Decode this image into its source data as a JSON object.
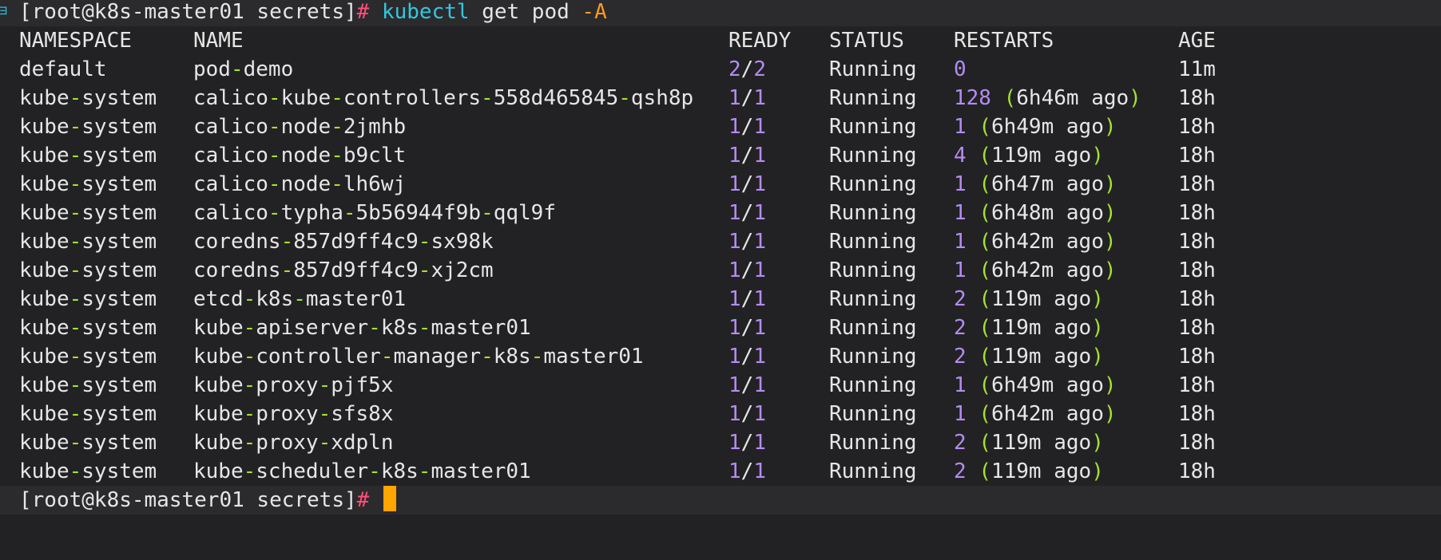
{
  "prompt": {
    "user_host": "[root@k8s-master01 secrets]",
    "symbol": "#",
    "command_name": "kubectl",
    "command_args": "get pod",
    "command_flag": "-A"
  },
  "table": {
    "headers": {
      "namespace": "NAMESPACE",
      "name": "NAME",
      "ready": "READY",
      "status": "STATUS",
      "restarts": "RESTARTS",
      "age": "AGE"
    },
    "rows": [
      {
        "namespace": "default",
        "name": "pod-demo",
        "ready": "2/2",
        "status": "Running",
        "restarts": "0",
        "ago": "",
        "age": "11m"
      },
      {
        "namespace": "kube-system",
        "name": "calico-kube-controllers-558d465845-qsh8p",
        "ready": "1/1",
        "status": "Running",
        "restarts": "128",
        "ago": "6h46m ago",
        "age": "18h"
      },
      {
        "namespace": "kube-system",
        "name": "calico-node-2jmhb",
        "ready": "1/1",
        "status": "Running",
        "restarts": "1",
        "ago": "6h49m ago",
        "age": "18h"
      },
      {
        "namespace": "kube-system",
        "name": "calico-node-b9clt",
        "ready": "1/1",
        "status": "Running",
        "restarts": "4",
        "ago": "119m ago",
        "age": "18h"
      },
      {
        "namespace": "kube-system",
        "name": "calico-node-lh6wj",
        "ready": "1/1",
        "status": "Running",
        "restarts": "1",
        "ago": "6h47m ago",
        "age": "18h"
      },
      {
        "namespace": "kube-system",
        "name": "calico-typha-5b56944f9b-qql9f",
        "ready": "1/1",
        "status": "Running",
        "restarts": "1",
        "ago": "6h48m ago",
        "age": "18h"
      },
      {
        "namespace": "kube-system",
        "name": "coredns-857d9ff4c9-sx98k",
        "ready": "1/1",
        "status": "Running",
        "restarts": "1",
        "ago": "6h42m ago",
        "age": "18h"
      },
      {
        "namespace": "kube-system",
        "name": "coredns-857d9ff4c9-xj2cm",
        "ready": "1/1",
        "status": "Running",
        "restarts": "1",
        "ago": "6h42m ago",
        "age": "18h"
      },
      {
        "namespace": "kube-system",
        "name": "etcd-k8s-master01",
        "ready": "1/1",
        "status": "Running",
        "restarts": "2",
        "ago": "119m ago",
        "age": "18h"
      },
      {
        "namespace": "kube-system",
        "name": "kube-apiserver-k8s-master01",
        "ready": "1/1",
        "status": "Running",
        "restarts": "2",
        "ago": "119m ago",
        "age": "18h"
      },
      {
        "namespace": "kube-system",
        "name": "kube-controller-manager-k8s-master01",
        "ready": "1/1",
        "status": "Running",
        "restarts": "2",
        "ago": "119m ago",
        "age": "18h"
      },
      {
        "namespace": "kube-system",
        "name": "kube-proxy-pjf5x",
        "ready": "1/1",
        "status": "Running",
        "restarts": "1",
        "ago": "6h49m ago",
        "age": "18h"
      },
      {
        "namespace": "kube-system",
        "name": "kube-proxy-sfs8x",
        "ready": "1/1",
        "status": "Running",
        "restarts": "1",
        "ago": "6h42m ago",
        "age": "18h"
      },
      {
        "namespace": "kube-system",
        "name": "kube-proxy-xdpln",
        "ready": "1/1",
        "status": "Running",
        "restarts": "2",
        "ago": "119m ago",
        "age": "18h"
      },
      {
        "namespace": "kube-system",
        "name": "kube-scheduler-k8s-master01",
        "ready": "1/1",
        "status": "Running",
        "restarts": "2",
        "ago": "119m ago",
        "age": "18h"
      }
    ]
  },
  "colors": {
    "background": "#222224",
    "text": "#e6e6e6",
    "dash": "#a6e22e",
    "number": "#b48cf2",
    "command": "#33c7de",
    "flag": "#ff9a1f",
    "cursor": "#ffa500"
  }
}
